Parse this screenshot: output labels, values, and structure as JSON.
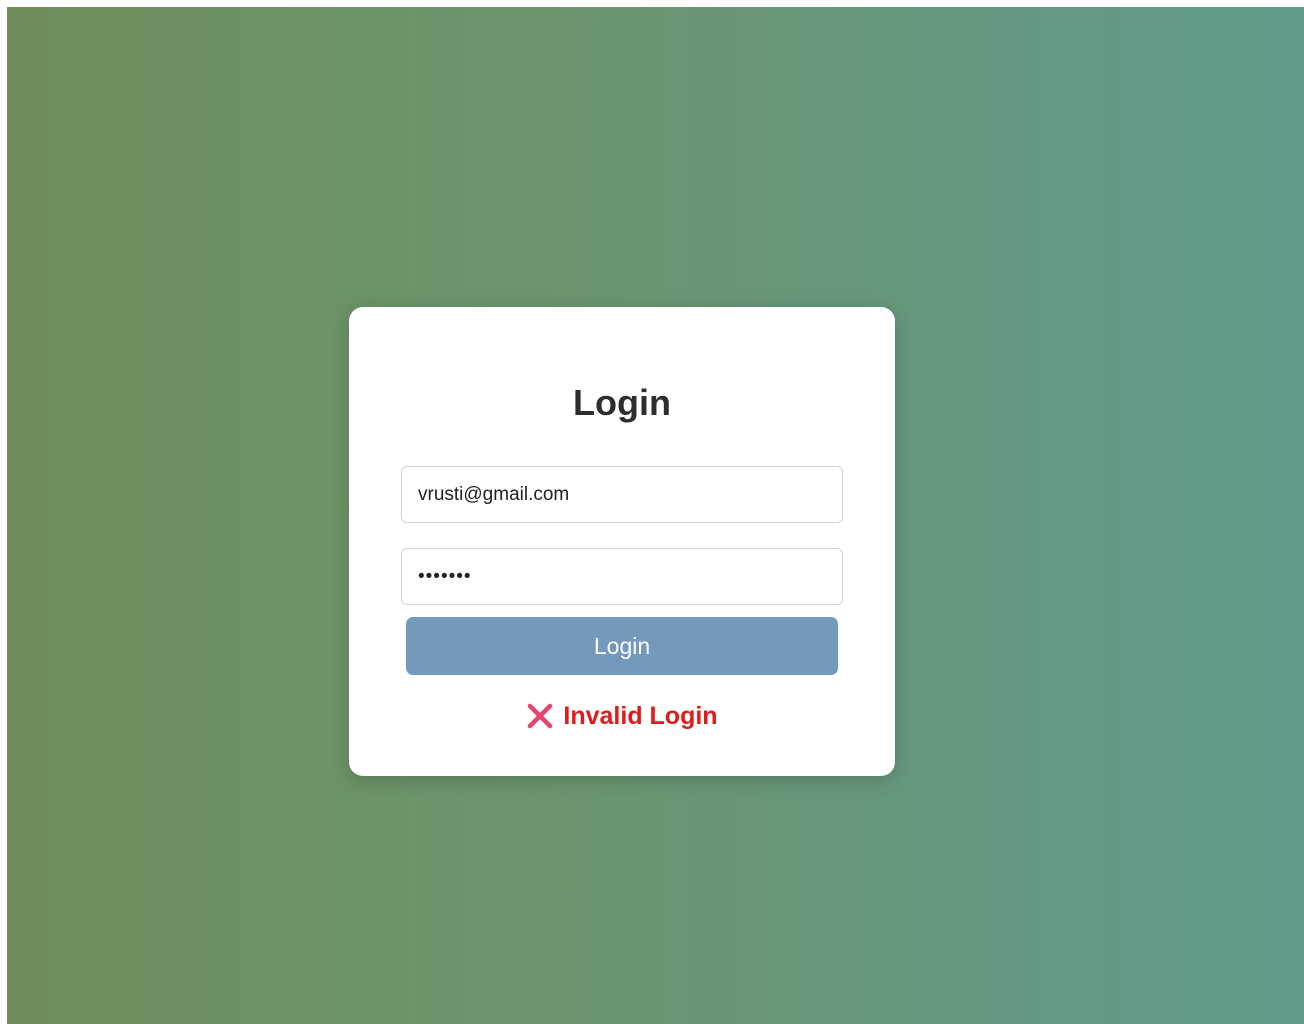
{
  "login_card": {
    "title": "Login",
    "email": {
      "value": "vrusti@gmail.com"
    },
    "password": {
      "value": "•••••••"
    },
    "submit_label": "Login",
    "error": {
      "icon": "close-x-icon",
      "message": "Invalid Login",
      "color": "#e01b1b",
      "icon_color": "#e8436b"
    }
  },
  "colors": {
    "background_left": "#6f8e5b",
    "background_right": "#619b8c",
    "button": "#7399bd",
    "card": "#ffffff",
    "title": "#2e2e2e"
  }
}
